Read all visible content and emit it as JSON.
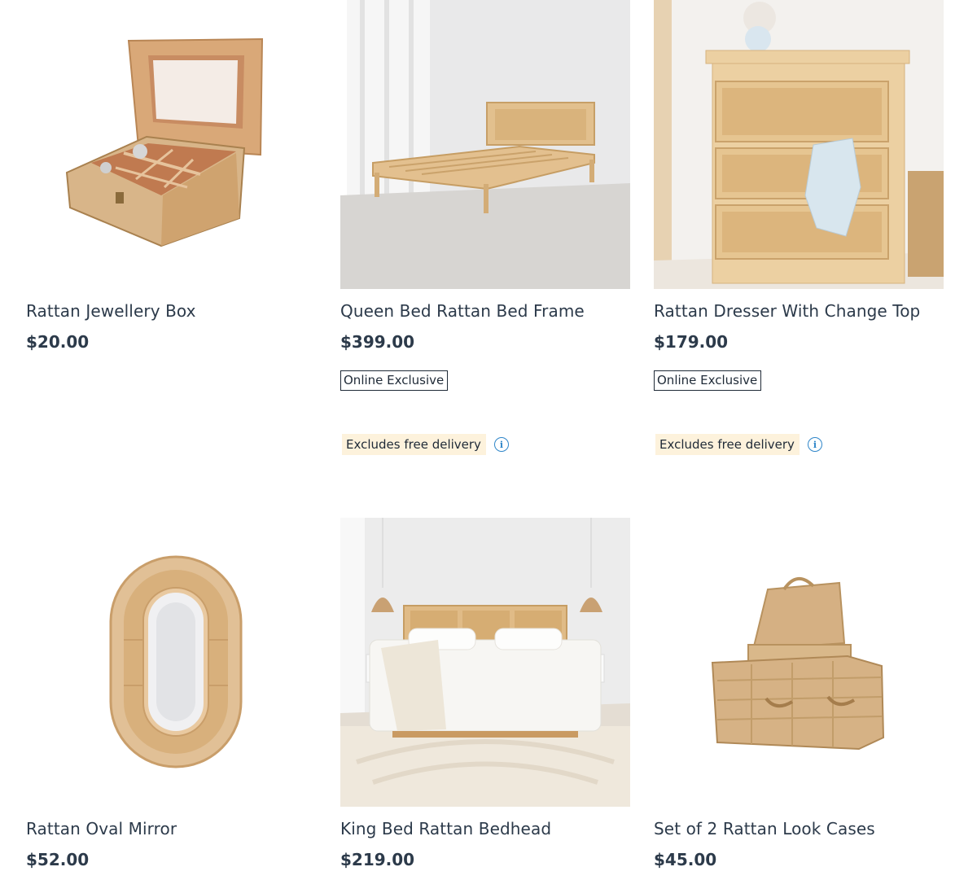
{
  "products": [
    {
      "title": "Rattan Jewellery Box",
      "price": "$20.00",
      "image_icon": "jewellery-box-image"
    },
    {
      "title": "Queen Bed Rattan Bed Frame",
      "price": "$399.00",
      "badge": "Online Exclusive",
      "delivery_note": "Excludes free delivery",
      "image_icon": "bed-frame-image"
    },
    {
      "title": "Rattan Dresser With Change Top",
      "price": "$179.00",
      "badge": "Online Exclusive",
      "delivery_note": "Excludes free delivery",
      "image_icon": "dresser-image"
    },
    {
      "title": "Rattan Oval Mirror",
      "price": "$52.00",
      "image_icon": "oval-mirror-image"
    },
    {
      "title": "King Bed Rattan Bedhead",
      "price": "$219.00",
      "image_icon": "bedhead-image"
    },
    {
      "title": "Set of 2 Rattan Look Cases",
      "price": "$45.00",
      "image_icon": "rattan-cases-image"
    }
  ],
  "info_icon_glyph": "i",
  "colors": {
    "text": "#2c3a4a",
    "delivery_bg": "#fdf2dc",
    "info_blue": "#2f86c9",
    "rattan": "#d9b98a",
    "wood": "#e3c08f"
  }
}
